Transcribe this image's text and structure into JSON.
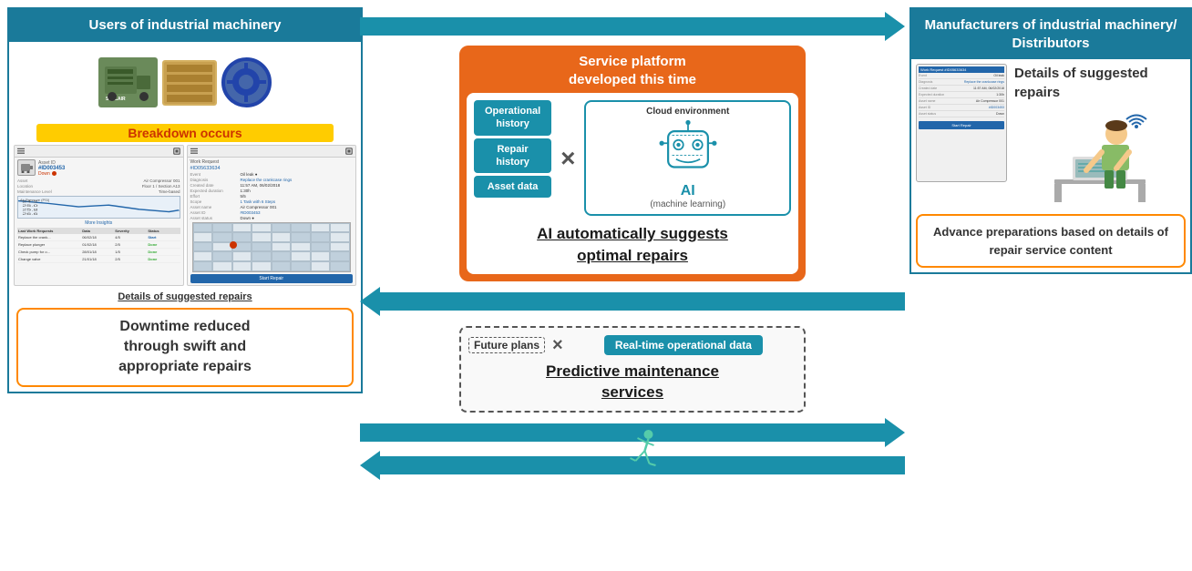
{
  "left_panel": {
    "header": "Users of industrial machinery",
    "breakdown_label": "Breakdown\noccurs",
    "suggested_repairs_label": "Details of suggested repairs",
    "downtime_box": "Downtime reduced\nthrough swift and\nappropriate repairs",
    "app_screen_1": {
      "asset_label": "Asset ID",
      "asset_id": "#ID003453",
      "status": "Down",
      "rows": [
        {
          "label": "Asset",
          "value": "Air Compressor 001"
        },
        {
          "label": "Location",
          "value": "Floor 1 / Section A13"
        },
        {
          "label": "Maintenance Level",
          "value": "Time-based"
        }
      ],
      "chart_label": "Air Pressure (PSI)",
      "chart_values": [
        26.6,
        25.8,
        25.0,
        24.2
      ],
      "more_insights": "More Insights",
      "table_headers": [
        "Last Work Requests",
        "Data",
        "Severity",
        "Status"
      ],
      "table_rows": [
        {
          "task": "Replace the crank...",
          "date": "06/02/18",
          "severity": "4/5",
          "status": "Start"
        },
        {
          "task": "Replace plunger",
          "date": "01/02/18",
          "severity": "2/5",
          "status": "Done"
        },
        {
          "task": "Check pump for o...",
          "date": "28/01/18",
          "severity": "1/5",
          "status": "Done"
        },
        {
          "task": "Change valve",
          "date": "21/01/18",
          "severity": "2/5",
          "status": "Done"
        }
      ]
    },
    "app_screen_2": {
      "work_request_label": "Work Request",
      "work_request_id": "#ID05633634",
      "rows": [
        {
          "label": "Event",
          "value": "Oil leak"
        },
        {
          "label": "Diagnosis",
          "value": "Replace the crankcase rings",
          "blue": true
        },
        {
          "label": "Created date",
          "value": "11:57 AM, 06/02/2018"
        },
        {
          "label": "Expected duration",
          "value": "1:30h"
        },
        {
          "label": "Effort",
          "value": "5/5"
        },
        {
          "label": "Scope",
          "value": "1 Task with 6 Steps",
          "blue": true
        },
        {
          "label": "Asset name",
          "value": "Air Compressor 001"
        },
        {
          "label": "Asset ID",
          "value": "#ID003453",
          "blue": true
        },
        {
          "label": "Asset status",
          "value": "Down"
        }
      ],
      "start_repair": "Start Repair"
    }
  },
  "center_panel": {
    "platform_title": "Service platform\ndeveloped this time",
    "data_boxes": [
      "Operational\nhistory",
      "Repair\nhistory",
      "Asset data"
    ],
    "cloud_label": "Cloud environment",
    "ai_label": "AI",
    "ai_subtitle": "(machine learning)",
    "times_symbol": "×",
    "ai_suggests": "AI automatically suggests\noptimal repairs",
    "future_plans_label": "Future plans",
    "realtime_box": "Real-time operational data",
    "predictive_text": "Predictive maintenance\nservices"
  },
  "right_panel": {
    "header": "Manufacturers of\nindustrial machinery/\nDistributors",
    "details_label": "Details of\nsuggested\nrepairs",
    "advance_box": "Advance\npreparations\nbased on details\nof repair service\ncontent",
    "tablet": {
      "header": "Work Request  #ID05633634",
      "rows": [
        {
          "label": "Event",
          "value": "Oil leak"
        },
        {
          "label": "Diagnosis",
          "value": "Replace the crankcase rings"
        },
        {
          "label": "Created date",
          "value": "11:57 AM, 06/02/2018"
        },
        {
          "label": "Expected duration",
          "value": "1:30h"
        },
        {
          "label": "Asset name",
          "value": "Air Compressor 001"
        },
        {
          "label": "Asset ID",
          "value": "#ID003453"
        },
        {
          "label": "Asset status",
          "value": "Down"
        }
      ]
    }
  },
  "arrows": {
    "right_label": "→",
    "left_label": "←"
  },
  "icons": {
    "ai_brain": "🧠",
    "running_person": "🏃",
    "times": "×"
  }
}
